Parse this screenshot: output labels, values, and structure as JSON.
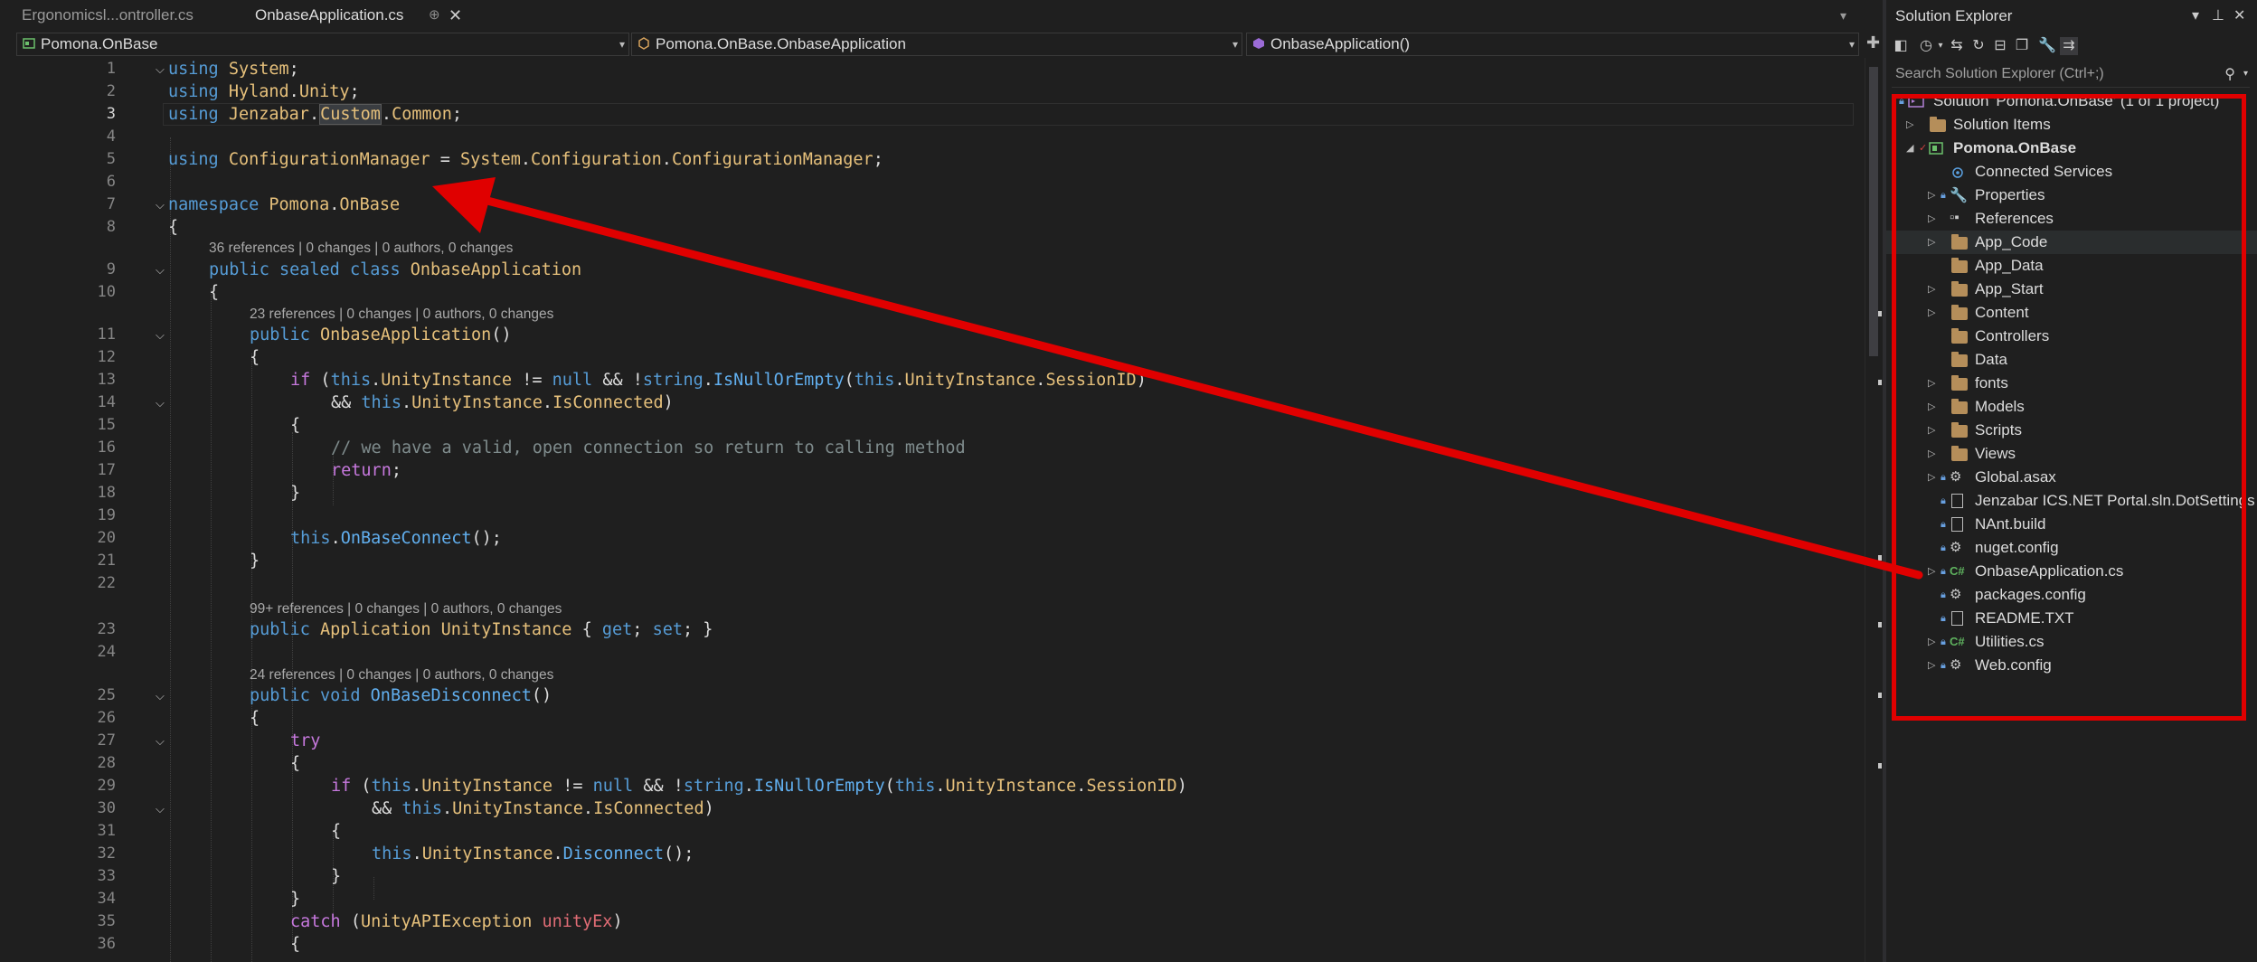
{
  "tabs": [
    {
      "label": "Ergonomicsl...ontroller.cs",
      "active": false
    },
    {
      "label": "OnbaseApplication.cs",
      "active": true
    }
  ],
  "tab_actions": {
    "pin": "⊕",
    "close": "✕"
  },
  "navbar": {
    "project": "Pomona.OnBase",
    "type": "Pomona.OnBase.OnbaseApplication",
    "member": "OnbaseApplication()"
  },
  "code": {
    "line_numbers": [
      "1",
      "2",
      "3",
      "4",
      "5",
      "6",
      "7",
      "8",
      "9",
      "10",
      "11",
      "12",
      "13",
      "14",
      "15",
      "16",
      "17",
      "18",
      "19",
      "20",
      "21",
      "22",
      "23",
      "24",
      "25",
      "26",
      "27",
      "28",
      "29",
      "30",
      "31",
      "32",
      "33",
      "34",
      "35",
      "36"
    ],
    "lens_9": "36 references | 0 changes | 0 authors, 0 changes",
    "lens_11": "23 references | 0 changes | 0 authors, 0 changes",
    "lens_23": "99+ references | 0 changes | 0 authors, 0 changes",
    "lens_25": "24 references | 0 changes | 0 authors, 0 changes",
    "comment_16": "// we have a valid, open connection so return to calling method"
  },
  "solution_explorer": {
    "title": "Solution Explorer",
    "search_placeholder": "Search Solution Explorer (Ctrl+;)",
    "solution": "Solution 'Pomona.OnBase' (1 of 1 project)",
    "items": [
      {
        "label": "Solution Items",
        "icon": "folder-icon"
      },
      {
        "label": "Pomona.OnBase",
        "icon": "project-icon"
      },
      {
        "label": "Connected Services",
        "icon": "connected-services-icon"
      },
      {
        "label": "Properties",
        "icon": "wrench-icon"
      },
      {
        "label": "References",
        "icon": "references-icon"
      },
      {
        "label": "App_Code",
        "icon": "folder-icon"
      },
      {
        "label": "App_Data",
        "icon": "folder-icon"
      },
      {
        "label": "App_Start",
        "icon": "folder-icon"
      },
      {
        "label": "Content",
        "icon": "folder-icon"
      },
      {
        "label": "Controllers",
        "icon": "folder-icon"
      },
      {
        "label": "Data",
        "icon": "folder-icon"
      },
      {
        "label": "fonts",
        "icon": "folder-icon"
      },
      {
        "label": "Models",
        "icon": "folder-icon"
      },
      {
        "label": "Scripts",
        "icon": "folder-icon"
      },
      {
        "label": "Views",
        "icon": "folder-icon"
      },
      {
        "label": "Global.asax",
        "icon": "asax-icon"
      },
      {
        "label": "Jenzabar ICS.NET Portal.sln.DotSettings",
        "icon": "file-icon"
      },
      {
        "label": "NAnt.build",
        "icon": "file-icon"
      },
      {
        "label": "nuget.config",
        "icon": "config-icon"
      },
      {
        "label": "OnbaseApplication.cs",
        "icon": "csharp-icon"
      },
      {
        "label": "packages.config",
        "icon": "config-icon"
      },
      {
        "label": "README.TXT",
        "icon": "text-file-icon"
      },
      {
        "label": "Utilities.cs",
        "icon": "csharp-icon"
      },
      {
        "label": "Web.config",
        "icon": "config-icon"
      }
    ]
  },
  "colors": {
    "annotation": "#e00000",
    "editor_bg": "#1f1f1f",
    "keyword": "#569cd6",
    "type": "#e6c07b",
    "method": "#61afef",
    "control": "#c678dd"
  }
}
